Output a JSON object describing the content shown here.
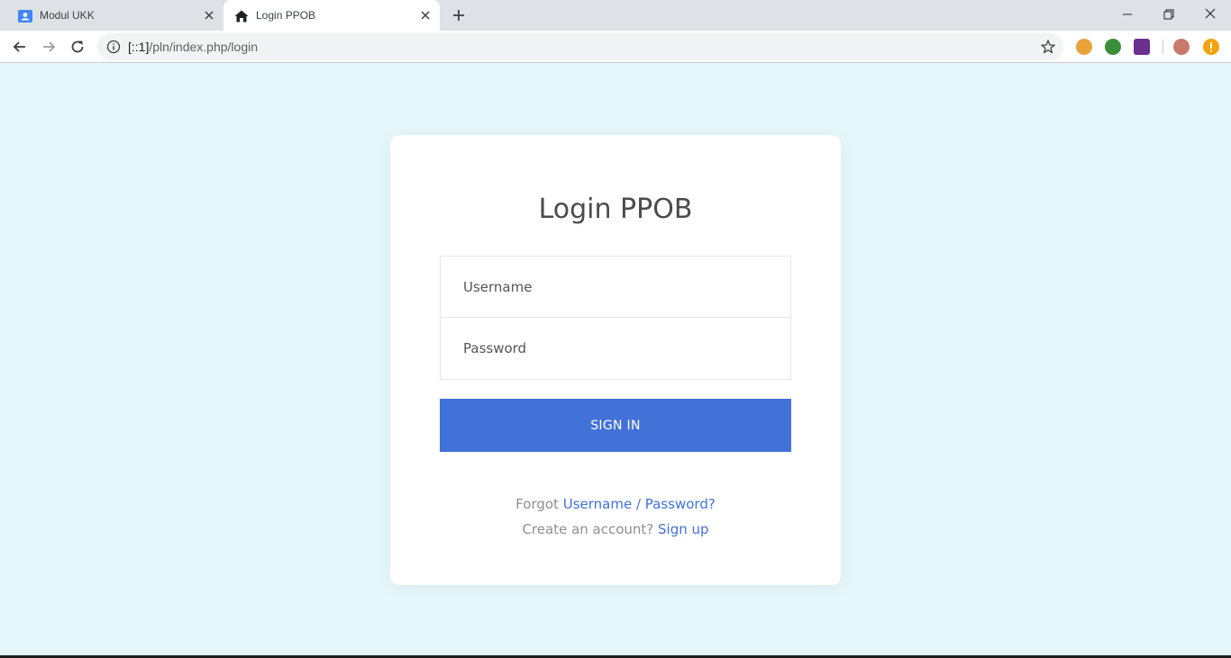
{
  "browser": {
    "tabs": [
      {
        "title": "Modul UKK",
        "active": false
      },
      {
        "title": "Login PPOB",
        "active": true
      }
    ],
    "url_host": "[::1]",
    "url_path": "/pln/index.php/login"
  },
  "login": {
    "title": "Login PPOB",
    "username_placeholder": "Username",
    "password_placeholder": "Password",
    "signin_label": "SIGN IN",
    "forgot_prefix": "Forgot",
    "forgot_link": "Username / Password?",
    "create_prefix": "Create an account?",
    "signup_link": "Sign up"
  },
  "colors": {
    "page_background": "#e6f7fc",
    "accent": "#4272d7",
    "card": "#ffffff"
  },
  "icons": {
    "modul-favicon": "contact-card-icon",
    "login-favicon": "home-icon"
  }
}
